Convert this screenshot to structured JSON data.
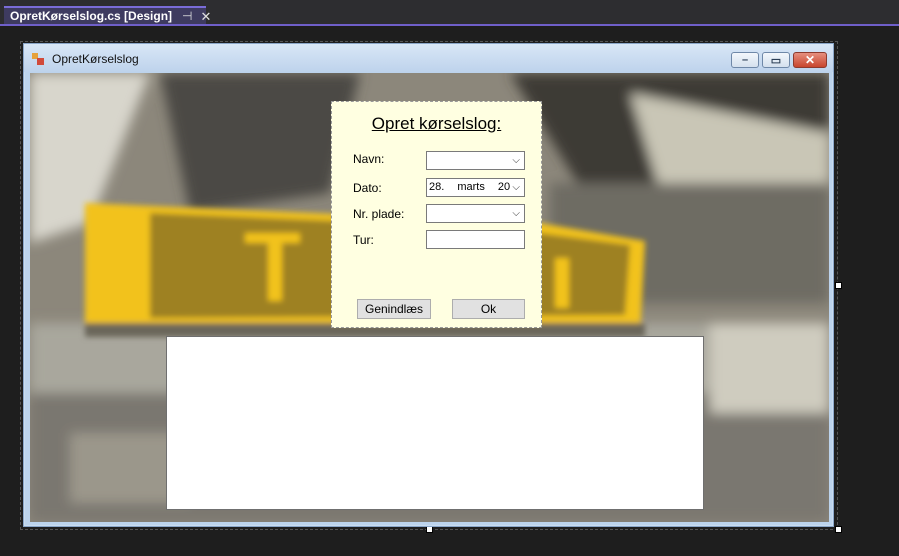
{
  "tab": {
    "title": "OpretKørselslog.cs [Design]",
    "pin_icon": "pin-icon",
    "close_icon": "close-icon"
  },
  "window": {
    "title": "OpretKørselslog",
    "controls": {
      "minimize": "minimize-icon",
      "maximize": "maximize-icon",
      "close": "close-icon"
    }
  },
  "form": {
    "heading": "Opret kørselslog:",
    "labels": {
      "navn": "Navn:",
      "dato": "Dato:",
      "nrplade": "Nr. plade:",
      "tur": "Tur:"
    },
    "navn_value": "",
    "dato_value": {
      "day": "28.",
      "month": "marts",
      "year": "20"
    },
    "nrplade_value": "",
    "tur_value": "",
    "buttons": {
      "reload": "Genindlæs",
      "ok": "Ok"
    }
  },
  "output_textbox": {
    "value": ""
  },
  "colors": {
    "panel_bg": "#ffffe1",
    "tab_accent": "#6f5fc9",
    "taxi_yellow": "#f2c21a"
  }
}
